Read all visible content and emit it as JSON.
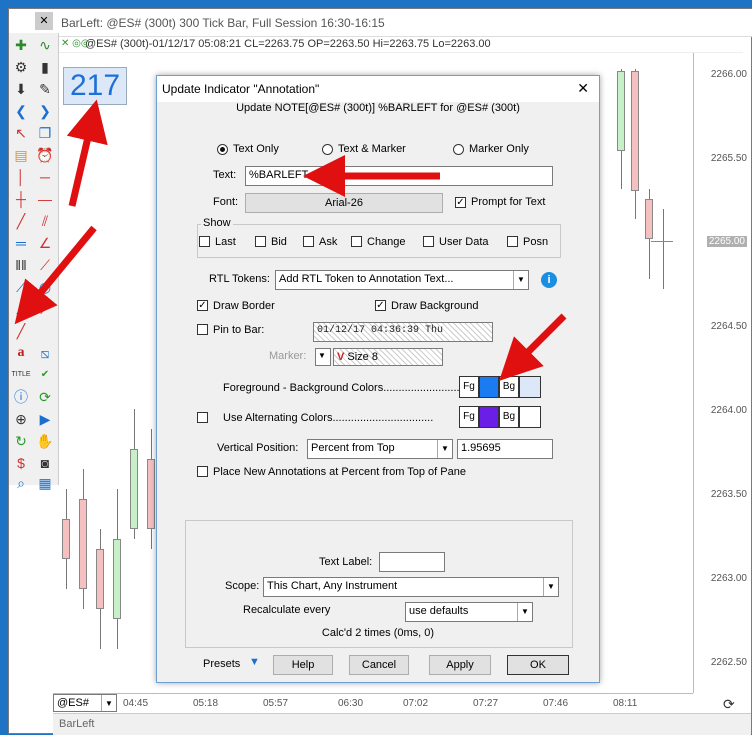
{
  "window": {
    "title": "BarLeft: @ES# (300t) 300 Tick Bar, Full Session 16:30-16:15",
    "info_line": "@ES# (300t)-01/12/17 05:08:21 CL=2263.75 OP=2263.50 Hi=2263.75 Lo=2263.00",
    "annotation_value": "217",
    "current_price": "2265.00",
    "price_labels": [
      "2266.00",
      "2265.50",
      "2265.00",
      "2264.50",
      "2264.00",
      "2263.50",
      "2263.00",
      "2262.50"
    ],
    "time_labels": [
      "04:45",
      "05:18",
      "05:57",
      "06:30",
      "07:02",
      "07:27",
      "07:46",
      "08:11"
    ],
    "symbol": "@ES#",
    "tab_label": "BarLeft"
  },
  "dialog": {
    "title": "Update Indicator \"Annotation\"",
    "subtitle": "Update NOTE[@ES# (300t)] %BARLEFT for @ES# (300t)",
    "close": "✕",
    "mode_options": [
      "Text Only",
      "Text & Marker",
      "Marker Only"
    ],
    "text_label": "Text:",
    "text_value": "%BARLEFT",
    "font_label": "Font:",
    "font_value": "Arial-26",
    "prompt_label": "Prompt for Text",
    "show_label": "Show",
    "show_items": [
      "Last",
      "Bid",
      "Ask",
      "Change",
      "User Data",
      "Posn"
    ],
    "rtl_label": "RTL Tokens:",
    "rtl_value": "Add RTL Token to Annotation Text...",
    "info_glyph": "i",
    "draw_border": "Draw Border",
    "draw_background": "Draw Background",
    "pin_to_bar": "Pin to Bar:",
    "pin_value": "01/12/17  04:36:39  Thu",
    "marker_label": "Marker:",
    "marker_size": "Size 8",
    "fg_bg_label": "Foreground - Background Colors.........................",
    "alt_colors_label": "Use Alternating Colors.................................",
    "fg": "Fg",
    "bg": "Bg",
    "vpos_label": "Vertical Position:",
    "vpos_value": "Percent from Top",
    "vpos_number": "1.95695",
    "place_new_label": "Place New Annotations at Percent from Top of Pane",
    "text_label2": "Text Label:",
    "scope_label": "Scope:",
    "scope_value": "This Chart, Any Instrument",
    "recalc_label": "Recalculate every",
    "recalc_value": "use defaults",
    "calc_status": "Calc'd 2 times (0ms, 0)",
    "presets": "Presets",
    "help": "Help",
    "cancel": "Cancel",
    "apply": "Apply",
    "ok": "OK"
  },
  "colors": {
    "fg_color": "#1a7cf0",
    "bg_color": "#dce8f8",
    "alt_fg_color": "#6a1ee6",
    "alt_bg_color": "#ffffff",
    "annotation_color": "#1e6fd8",
    "arrow": "#e01010"
  }
}
